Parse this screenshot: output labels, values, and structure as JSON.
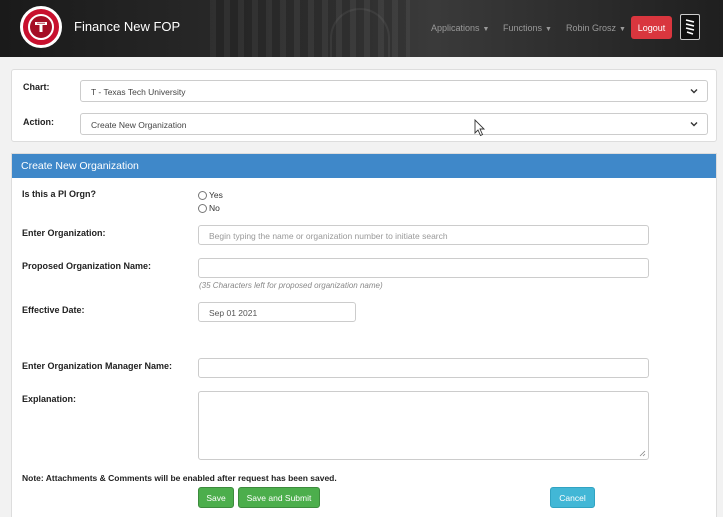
{
  "header": {
    "app_title": "Finance New FOP",
    "nav": [
      {
        "label": "Applications"
      },
      {
        "label": "Functions"
      },
      {
        "label": "Robin Grosz"
      }
    ],
    "logout_label": "Logout"
  },
  "selection": {
    "chart_label": "Chart:",
    "chart_value": "T - Texas Tech University",
    "action_label": "Action:",
    "action_value": "Create New Organization"
  },
  "form": {
    "panel_title": "Create New Organization",
    "pi_orgn_label": "Is this a PI Orgn?",
    "pi_options": [
      "Yes",
      "No"
    ],
    "enter_org_label": "Enter Organization:",
    "enter_org_placeholder": "Begin typing the name or organization number to initiate search",
    "proposed_name_label": "Proposed Organization Name:",
    "proposed_name_value": "",
    "proposed_name_helper": "(35 Characters left for proposed organization name)",
    "effective_date_label": "Effective Date:",
    "effective_date_value": "Sep 01 2021",
    "manager_label": "Enter Organization Manager Name:",
    "manager_value": "",
    "explanation_label": "Explanation:",
    "note": "Note: Attachments & Comments will be enabled after request has been saved.",
    "save_label": "Save",
    "save_submit_label": "Save and Submit",
    "cancel_label": "Cancel"
  },
  "colors": {
    "accent_red": "#c8102e",
    "panel_blue": "#3f88c9",
    "button_green": "#4cae4c",
    "button_cyan": "#42b7d6",
    "logout_red": "#d9363e"
  }
}
